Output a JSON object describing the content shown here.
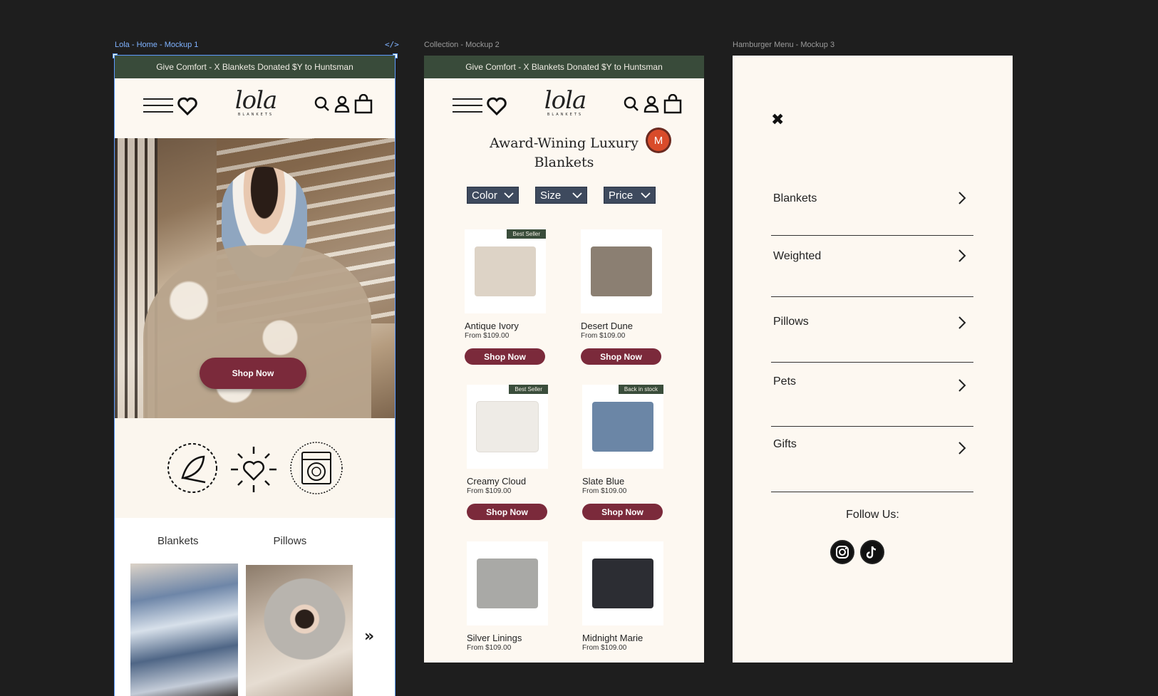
{
  "frames": {
    "home": {
      "label": "Lola - Home - Mockup 1"
    },
    "collection": {
      "label": "Collection - Mockup 2"
    },
    "menu": {
      "label": "Hamburger Menu - Mockup 3"
    }
  },
  "code_icon": "</>",
  "banner": {
    "text": "Give Comfort - X Blankets Donated $Y to Huntsman"
  },
  "logo": {
    "script": "lola",
    "sub": "BLANKETS"
  },
  "home": {
    "hero_button": "Shop Now",
    "categories": [
      "Blankets",
      "Pillows"
    ]
  },
  "collection": {
    "title_line1": "Award-Wining Luxury",
    "title_line2": "Blankets",
    "avatar": "M",
    "filters": [
      "Color",
      "Size",
      "Price"
    ],
    "products": [
      {
        "name": "Antique Ivory",
        "price": "From $109.00",
        "badge": "Best Seller",
        "button": "Shop Now",
        "color": "#ddd3c6"
      },
      {
        "name": "Desert Dune",
        "price": "From $109.00",
        "badge": "",
        "button": "Shop Now",
        "color": "#8b7f72"
      },
      {
        "name": "Creamy Cloud",
        "price": "From $109.00",
        "badge": "Best Seller",
        "button": "Shop Now",
        "color": "#eeebe6"
      },
      {
        "name": "Slate Blue",
        "price": "From $109.00",
        "badge": "Back in stock",
        "button": "Shop Now",
        "color": "#6b86a6"
      },
      {
        "name": "Silver Linings",
        "price": "From $109.00",
        "badge": "",
        "button": "",
        "color": "#a9a9a6"
      },
      {
        "name": "Midnight Marie",
        "price": "From $109.00",
        "badge": "",
        "button": "",
        "color": "#2c2d33"
      }
    ]
  },
  "menu": {
    "items": [
      "Blankets",
      "Weighted",
      "Pillows",
      "Pets",
      "Gifts"
    ],
    "follow": "Follow Us:"
  },
  "colors": {
    "banner": "#394b3a",
    "accent": "#7b2a3b",
    "cream": "#fdf8f1",
    "filter": "#3e4a5e"
  }
}
